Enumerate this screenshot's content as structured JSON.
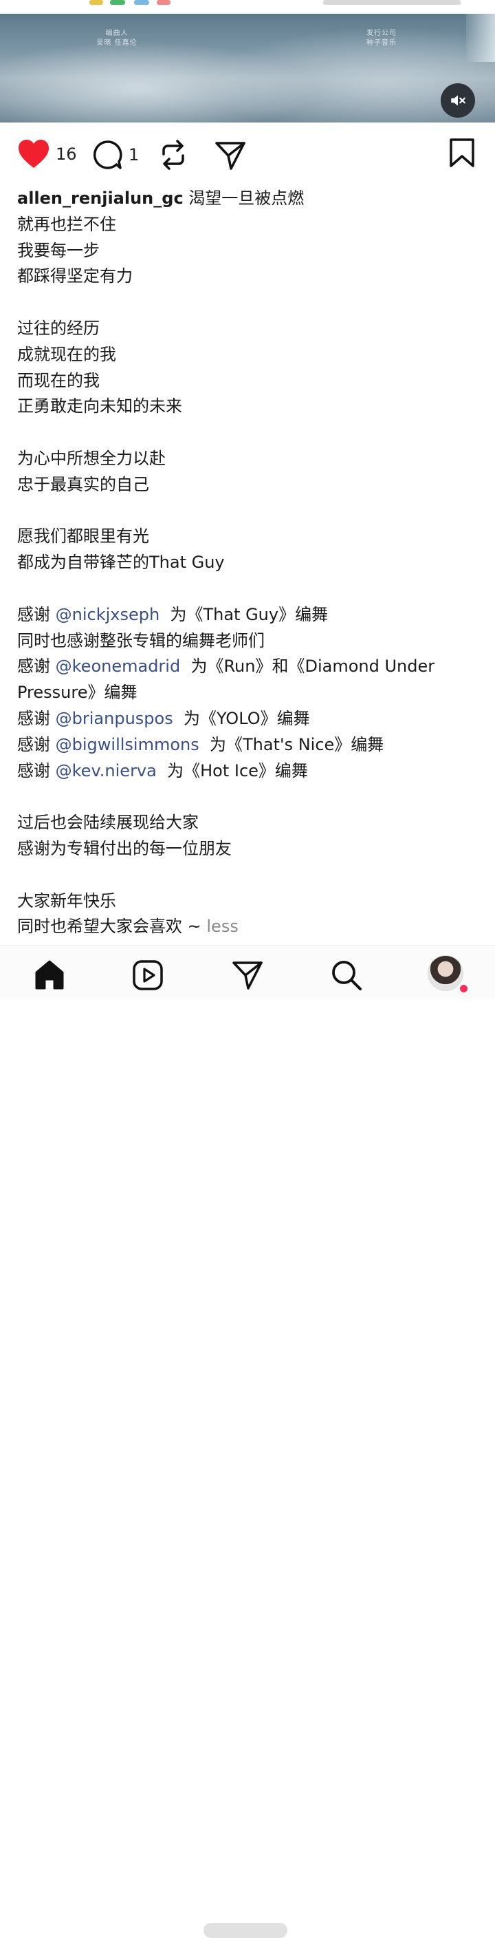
{
  "colors": {
    "like_red": "#f0202f",
    "mention_blue": "#3a4f86",
    "more_gray": "#8a8a8a",
    "notification_dot": "#ff2d55"
  },
  "video": {
    "credit_left": [
      "编曲人",
      "吴晓 任嘉伦"
    ],
    "credit_right": [
      "发行公司",
      "种子音乐"
    ],
    "mute_icon": "speaker-muted-icon"
  },
  "actions": {
    "likes": "16",
    "comments": "1",
    "icons": [
      "heart-icon",
      "comment-icon",
      "repost-icon",
      "share-icon",
      "bookmark-icon"
    ]
  },
  "caption": {
    "username": "allen_renjialun_gc",
    "first_line": "渴望一旦被点燃",
    "lines_a": [
      "就再也拦不住",
      "我要每一步",
      "都踩得坚定有力"
    ],
    "lines_b": [
      "过往的经历",
      "成就现在的我",
      "而现在的我",
      "正勇敢走向未知的未来"
    ],
    "lines_c": [
      "为心中所想全力以赴",
      "忠于最真实的自己"
    ],
    "lines_d": [
      "愿我们都眼里有光",
      "都成为自带锋芒的That Guy"
    ],
    "thanks": [
      {
        "pre": "感谢 ",
        "mention": "@nickjxseph",
        "post": "  为《That Guy》编舞"
      },
      {
        "pre": "同时也感谢整张专辑的编舞老师们",
        "mention": "",
        "post": ""
      },
      {
        "pre": "感谢 ",
        "mention": "@keonemadrid",
        "post": "  为《Run》和《Diamond Under"
      },
      {
        "pre": "Pressure》编舞",
        "mention": "",
        "post": ""
      },
      {
        "pre": "感谢 ",
        "mention": "@brianpuspos",
        "post": "  为《YOLO》编舞"
      },
      {
        "pre": "感谢 ",
        "mention": "@bigwillsimmons",
        "post": "  为《That's Nice》编舞"
      },
      {
        "pre": "感谢 ",
        "mention": "@kev.nierva",
        "post": "  为《Hot Ice》编舞"
      }
    ],
    "lines_e": [
      "过后也会陆续展现给大家",
      "感谢为专辑付出的每一位朋友"
    ],
    "lines_f": [
      "大家新年快乐"
    ],
    "last_line": "同时也希望大家会喜欢 ~",
    "less": "less"
  },
  "nav": {
    "items": [
      "home-icon",
      "reels-icon",
      "direct-icon",
      "search-icon",
      "profile-avatar"
    ]
  }
}
